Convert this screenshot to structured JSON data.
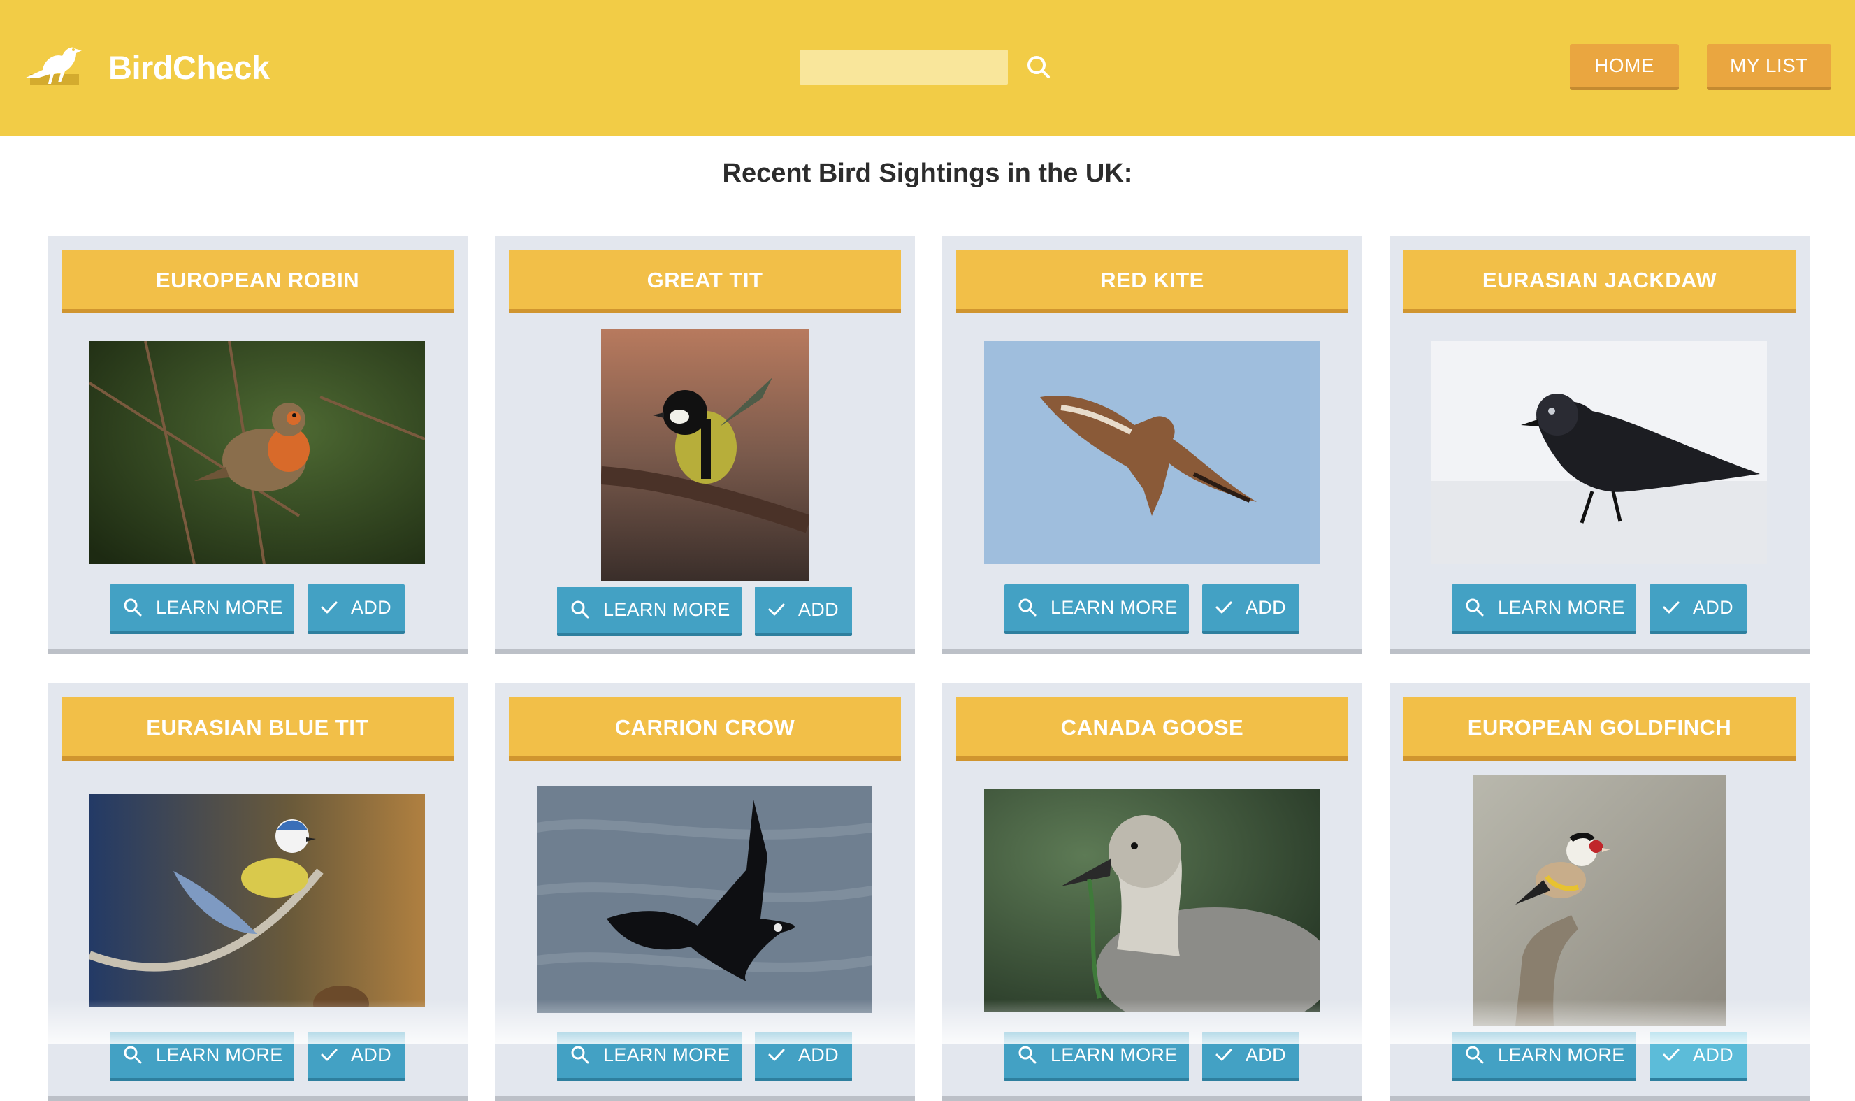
{
  "header": {
    "brand": "BirdCheck",
    "logo_icon": "bird-logo-icon",
    "search": {
      "value": "",
      "placeholder": "",
      "icon": "search-icon"
    },
    "nav": {
      "home": "HOME",
      "my_list": "MY LIST"
    },
    "colors": {
      "header_bg": "#f2cc46",
      "nav_button": "#eaa640"
    }
  },
  "main": {
    "title": "Recent Bird Sightings in the UK:",
    "button_labels": {
      "learn_more": "LEARN MORE",
      "add": "ADD"
    },
    "colors": {
      "card_bg": "#e3e7ee",
      "card_title_bg": "#f2bf48",
      "action_button": "#43a1c4"
    },
    "cards": [
      {
        "name": "EUROPEAN ROBIN",
        "photo": "european-robin-photo"
      },
      {
        "name": "GREAT TIT",
        "photo": "great-tit-photo"
      },
      {
        "name": "RED KITE",
        "photo": "red-kite-photo"
      },
      {
        "name": "EURASIAN JACKDAW",
        "photo": "eurasian-jackdaw-photo"
      },
      {
        "name": "EURASIAN BLUE TIT",
        "photo": "eurasian-blue-tit-photo"
      },
      {
        "name": "CARRION CROW",
        "photo": "carrion-crow-photo"
      },
      {
        "name": "CANADA GOOSE",
        "photo": "canada-goose-photo"
      },
      {
        "name": "EUROPEAN GOLDFINCH",
        "photo": "european-goldfinch-photo"
      }
    ]
  }
}
